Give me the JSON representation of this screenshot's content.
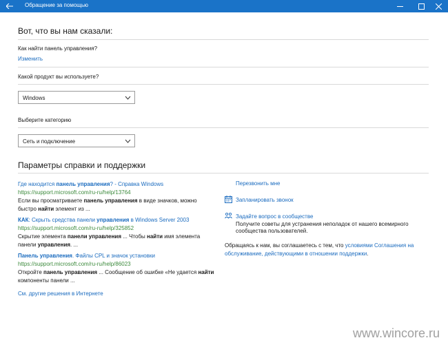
{
  "window": {
    "title": "Обращение за помощью"
  },
  "main": {
    "heading": "Вот, что вы нам сказали:",
    "question": "Как найти панель управления?",
    "change_link": "Изменить",
    "product_label": "Какой продукт вы используете?",
    "product_value": "Windows",
    "category_label": "Выберите категорию",
    "category_value": "Сеть и подключение",
    "support_heading": "Параметры справки и поддержки"
  },
  "results": [
    {
      "title_parts": [
        "Где находится ",
        "панель управления",
        "? - Справка Windows"
      ],
      "url": "https://support.microsoft.com/ru-ru/help/13764",
      "snippet_parts": [
        "Если вы просматриваете ",
        "панель управления",
        " в виде значков, можно быстро ",
        "найти",
        " элемент из ..."
      ]
    },
    {
      "title_parts": [
        "КАК",
        ": Скрыть средства панели ",
        "управления",
        " в Windows Server 2003"
      ],
      "url": "https://support.microsoft.com/ru-ru/help/325852",
      "snippet_parts": [
        "Скрытие элемента ",
        "панели управления",
        " ... Чтобы ",
        "найти",
        " имя элемента панели ",
        "управления",
        ". ..."
      ]
    },
    {
      "title_parts": [
        "Панель управления",
        ". Файлы CPL и значок установки"
      ],
      "url": "https://support.microsoft.com/ru-ru/help/86023",
      "snippet_parts": [
        "Откройте ",
        "панель управления",
        " ... Сообщение об ошибке «Не удается ",
        "найти",
        " компоненты панели ..."
      ]
    }
  ],
  "more_link": "См. другие решения в Интернете",
  "side": {
    "callback": "Перезвонить мне",
    "schedule": "Запланировать звонок",
    "community": "Задайте вопрос в сообществе",
    "community_desc_1": "Получите советы для устранения неполадок от нашего всемирного",
    "community_desc_2": "сообщества пользователей.",
    "agree_1": "Обращаясь к нам, вы соглашаетесь с тем, что ",
    "agree_link_1": "условиями Соглашения на",
    "agree_link_2": "обслуживание, действующими в отношении поддержки",
    "agree_end": "."
  },
  "watermark": "www.wincore.ru",
  "colors": {
    "titlebar": "#1a73c8",
    "link": "#1a6bbf",
    "url": "#3c8a3c"
  },
  "icons": {
    "back": "back-arrow-icon",
    "minimize": "minimize-icon",
    "maximize": "maximize-icon",
    "close": "close-icon",
    "schedule": "calendar-icon",
    "community": "people-icon",
    "dropdown": "chevron-down-icon"
  }
}
